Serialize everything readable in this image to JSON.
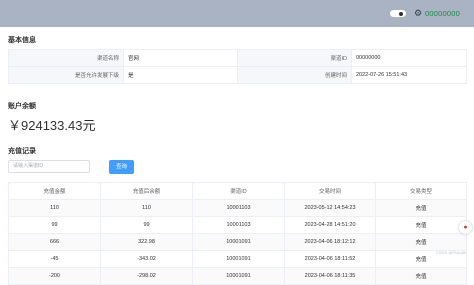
{
  "header": {
    "user_name": "00000000",
    "settings_icon": "gear-icon",
    "toggle_icon": "toggle-switch-icon"
  },
  "basic_info": {
    "title": "基本信息",
    "rows": [
      {
        "k1": "渠道名称",
        "v1": "官网",
        "k2": "渠道ID",
        "v2": "00000000"
      },
      {
        "k1": "是否允许发展下级",
        "v1": "是",
        "k2": "创建时间",
        "v2": "2022-07-26 15:51:43"
      }
    ]
  },
  "account": {
    "title": "账户余额",
    "balance": "￥924133.43元"
  },
  "recharge": {
    "title": "充值记录",
    "search_placeholder": "请输入渠道ID",
    "search_button": "查询",
    "columns": [
      "充值金额",
      "充值后余额",
      "渠道ID",
      "交易时间",
      "交易类型"
    ],
    "rows": [
      [
        "110",
        "110",
        "10001103",
        "2023-05-12 14:54:23",
        "充值"
      ],
      [
        "99",
        "99",
        "10001103",
        "2023-04-28 14:51:20",
        "充值"
      ],
      [
        "666",
        "322.98",
        "10001091",
        "2023-04-06 18:12:12",
        "充值"
      ],
      [
        "-45",
        "-343.02",
        "10001091",
        "2023-04-06 18:11:52",
        "充值"
      ],
      [
        "-200",
        "-298.02",
        "10001091",
        "2023-04-06 18:11:35",
        "充值"
      ]
    ]
  },
  "watermark": "CSDN @Pluto86",
  "float_icon": "chat-icon"
}
